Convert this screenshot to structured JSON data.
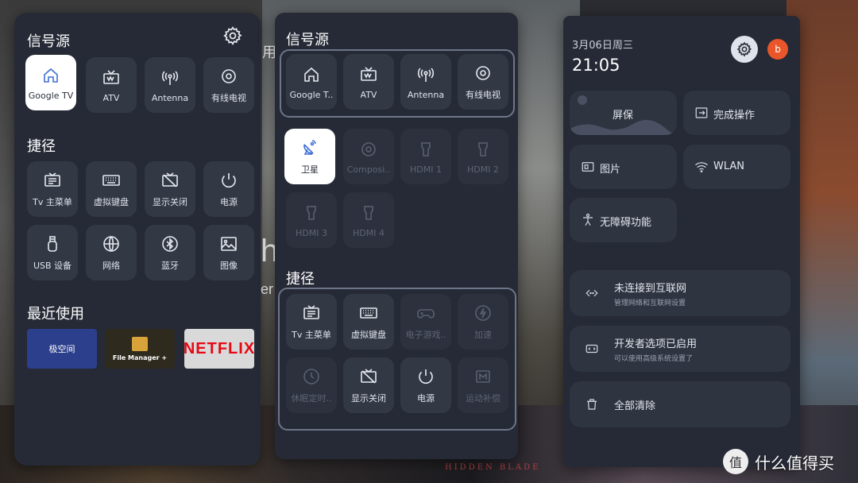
{
  "panel_left": {
    "sources_title": "信号源",
    "sources": [
      {
        "label": "Google TV",
        "icon": "home-icon",
        "selected": true
      },
      {
        "label": "ATV",
        "icon": "tv-antenna-icon"
      },
      {
        "label": "Antenna",
        "icon": "antenna-icon"
      },
      {
        "label": "有线电视",
        "icon": "gear-icon"
      }
    ],
    "shortcuts_title": "捷径",
    "shortcuts": [
      {
        "label": "Tv 主菜单",
        "icon": "tv-menu-icon"
      },
      {
        "label": "虚拟键盘",
        "icon": "keyboard-icon"
      },
      {
        "label": "显示关闭",
        "icon": "display-off-icon"
      },
      {
        "label": "电源",
        "icon": "power-icon"
      },
      {
        "label": "USB 设备",
        "icon": "usb-icon"
      },
      {
        "label": "网络",
        "icon": "globe-icon"
      },
      {
        "label": "蓝牙",
        "icon": "bluetooth-icon"
      },
      {
        "label": "图像",
        "icon": "image-icon"
      }
    ],
    "recent_title": "最近使用",
    "recent_apps": [
      {
        "name": "极空间",
        "bg": "#2c3f8c"
      },
      {
        "name": "File Manager +",
        "bg": "#2f2a1e"
      },
      {
        "name": "NETFLIX",
        "bg": "#d9d9d9",
        "color": "#e50914"
      }
    ]
  },
  "panel_middle": {
    "sources_title": "信号源",
    "sources": [
      {
        "label": "Google T..",
        "icon": "home-icon"
      },
      {
        "label": "ATV",
        "icon": "tv-antenna-icon"
      },
      {
        "label": "Antenna",
        "icon": "antenna-icon"
      },
      {
        "label": "有线电视",
        "icon": "gear-icon"
      },
      {
        "label": "卫星",
        "icon": "satellite-icon",
        "selected": true
      },
      {
        "label": "Composi..",
        "icon": "composite-icon",
        "disabled": true
      },
      {
        "label": "HDMI 1",
        "icon": "hdmi-icon",
        "disabled": true
      },
      {
        "label": "HDMI 2",
        "icon": "hdmi-icon",
        "disabled": true
      },
      {
        "label": "HDMI 3",
        "icon": "hdmi-icon",
        "disabled": true
      },
      {
        "label": "HDMI 4",
        "icon": "hdmi-icon",
        "disabled": true
      }
    ],
    "shortcuts_title": "捷径",
    "shortcuts": [
      {
        "label": "Tv 主菜单",
        "icon": "tv-menu-icon"
      },
      {
        "label": "虚拟键盘",
        "icon": "keyboard-icon"
      },
      {
        "label": "电子游戏..",
        "icon": "gamepad-icon",
        "disabled": true
      },
      {
        "label": "加速",
        "icon": "boost-icon",
        "disabled": true
      },
      {
        "label": "休眠定时..",
        "icon": "clock-icon",
        "disabled": true
      },
      {
        "label": "显示关闭",
        "icon": "display-off-icon"
      },
      {
        "label": "电源",
        "icon": "power-icon"
      },
      {
        "label": "运动补偿",
        "icon": "motion-icon",
        "disabled": true
      }
    ]
  },
  "panel_right": {
    "date": "3月06日周三",
    "time": "21:05",
    "avatar_letter": "b",
    "avatar_color": "#e8562a",
    "quick_tiles": [
      {
        "label": "屏保",
        "icon": "screensaver-icon"
      },
      {
        "label": "完成操作",
        "icon": "exit-icon"
      },
      {
        "label": "图片",
        "icon": "picture-icon"
      },
      {
        "label": "WLAN",
        "icon": "wifi-icon"
      },
      {
        "label": "无障碍功能",
        "icon": "accessibility-icon"
      }
    ],
    "notifications": [
      {
        "title": "未连接到互联网",
        "subtitle": "管理网络和互联网设置",
        "icon": "network-code-icon"
      },
      {
        "title": "开发者选项已启用",
        "subtitle": "可以使用高级系统设置了",
        "icon": "developer-icon"
      }
    ],
    "clear_all": "全部清除"
  },
  "background": {
    "texts": [
      "用",
      "h",
      "er",
      "HIDDEN BLADE"
    ]
  },
  "watermark": {
    "badge": "值",
    "text": "什么值得买"
  }
}
